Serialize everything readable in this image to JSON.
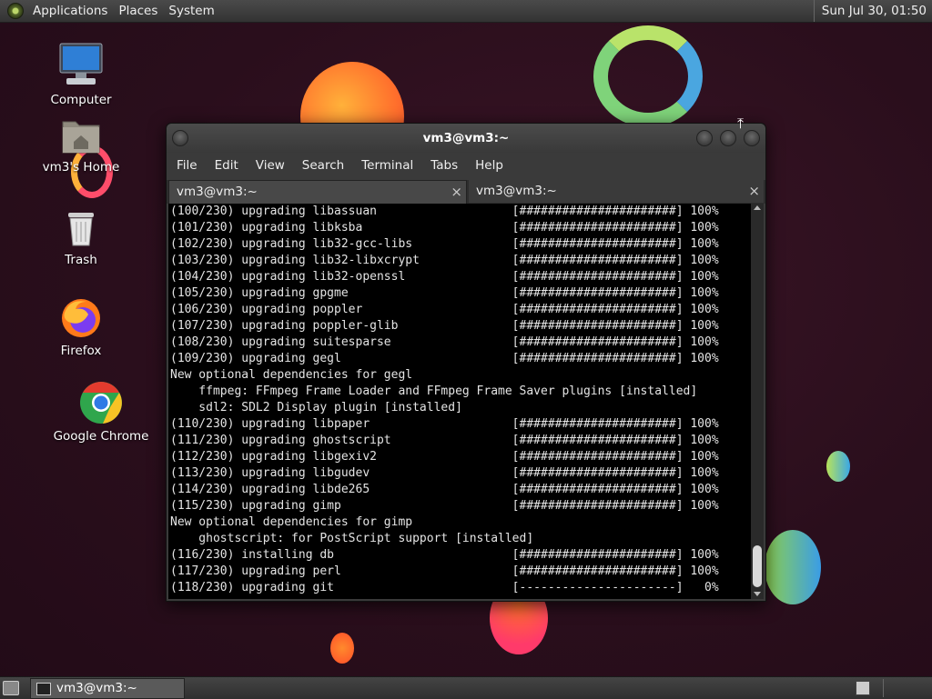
{
  "top_panel": {
    "menus": [
      "Applications",
      "Places",
      "System"
    ],
    "clock": "Sun Jul 30, 01:50"
  },
  "desktop": {
    "icons": [
      {
        "label": "Computer",
        "icon": "computer-icon"
      },
      {
        "label": "vm3's Home",
        "icon": "home-folder-icon"
      },
      {
        "label": "Trash",
        "icon": "trash-icon"
      },
      {
        "label": "Firefox",
        "icon": "firefox-icon"
      },
      {
        "label": "Google Chrome",
        "icon": "chrome-icon"
      }
    ]
  },
  "window": {
    "title": "vm3@vm3:~",
    "menu": [
      "File",
      "Edit",
      "View",
      "Search",
      "Terminal",
      "Tabs",
      "Help"
    ],
    "tabs": [
      {
        "label": "vm3@vm3:~",
        "active": true
      },
      {
        "label": "vm3@vm3:~",
        "active": false
      }
    ],
    "close_glyph": "×",
    "terminal_lines": [
      "(100/230) upgrading libassuan                   [######################] 100%",
      "(101/230) upgrading libksba                     [######################] 100%",
      "(102/230) upgrading lib32-gcc-libs              [######################] 100%",
      "(103/230) upgrading lib32-libxcrypt             [######################] 100%",
      "(104/230) upgrading lib32-openssl               [######################] 100%",
      "(105/230) upgrading gpgme                       [######################] 100%",
      "(106/230) upgrading poppler                     [######################] 100%",
      "(107/230) upgrading poppler-glib                [######################] 100%",
      "(108/230) upgrading suitesparse                 [######################] 100%",
      "(109/230) upgrading gegl                        [######################] 100%",
      "New optional dependencies for gegl",
      "    ffmpeg: FFmpeg Frame Loader and FFmpeg Frame Saver plugins [installed]",
      "    sdl2: SDL2 Display plugin [installed]",
      "(110/230) upgrading libpaper                    [######################] 100%",
      "(111/230) upgrading ghostscript                 [######################] 100%",
      "(112/230) upgrading libgexiv2                   [######################] 100%",
      "(113/230) upgrading libgudev                    [######################] 100%",
      "(114/230) upgrading libde265                    [######################] 100%",
      "(115/230) upgrading gimp                        [######################] 100%",
      "New optional dependencies for gimp",
      "    ghostscript: for PostScript support [installed]",
      "(116/230) installing db                         [######################] 100%",
      "(117/230) upgrading perl                        [######################] 100%",
      "(118/230) upgrading git                         [----------------------]   0%"
    ]
  },
  "taskbar": {
    "items": [
      {
        "label": "vm3@vm3:~"
      }
    ]
  }
}
